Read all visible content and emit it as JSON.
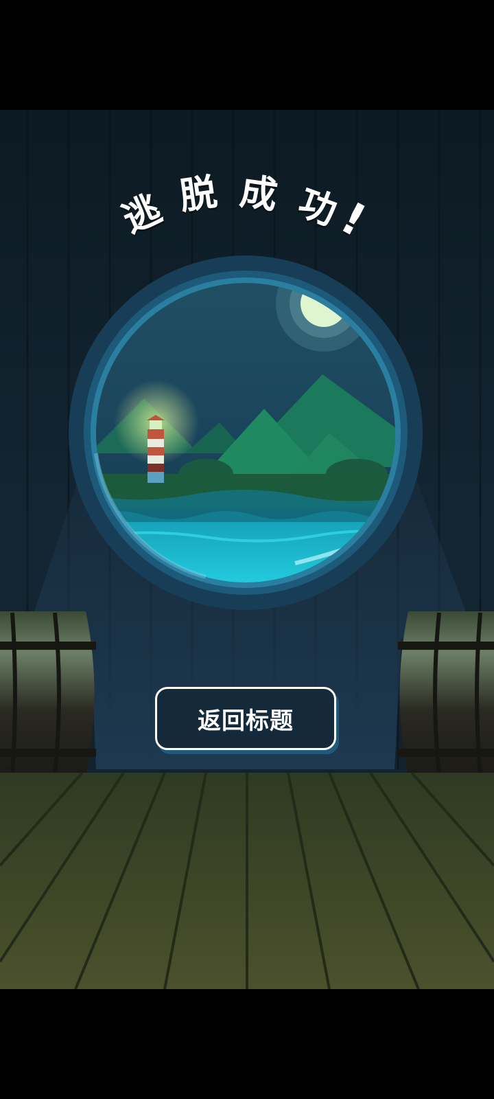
{
  "screen": {
    "title_chars": [
      "逃",
      "脱",
      "成",
      "功",
      "!"
    ],
    "return_button_label": "返回标题"
  },
  "scene": {
    "illustration": "porthole-view-night-sea-lighthouse",
    "elements": [
      "wall-planks",
      "barrel-left",
      "barrel-right",
      "deck-floor",
      "porthole",
      "moon",
      "mountains",
      "lighthouse",
      "sea"
    ],
    "colors": {
      "wall": "#142634",
      "porthole_rim": "#1d5a79",
      "sky": "#17445a",
      "mountain": "#1e7a5c",
      "sea": "#1ed0e4",
      "moon": "#dff5d0",
      "floor": "#3f4a26",
      "button_bg": "#142a3a",
      "button_border": "#ffffff"
    }
  }
}
